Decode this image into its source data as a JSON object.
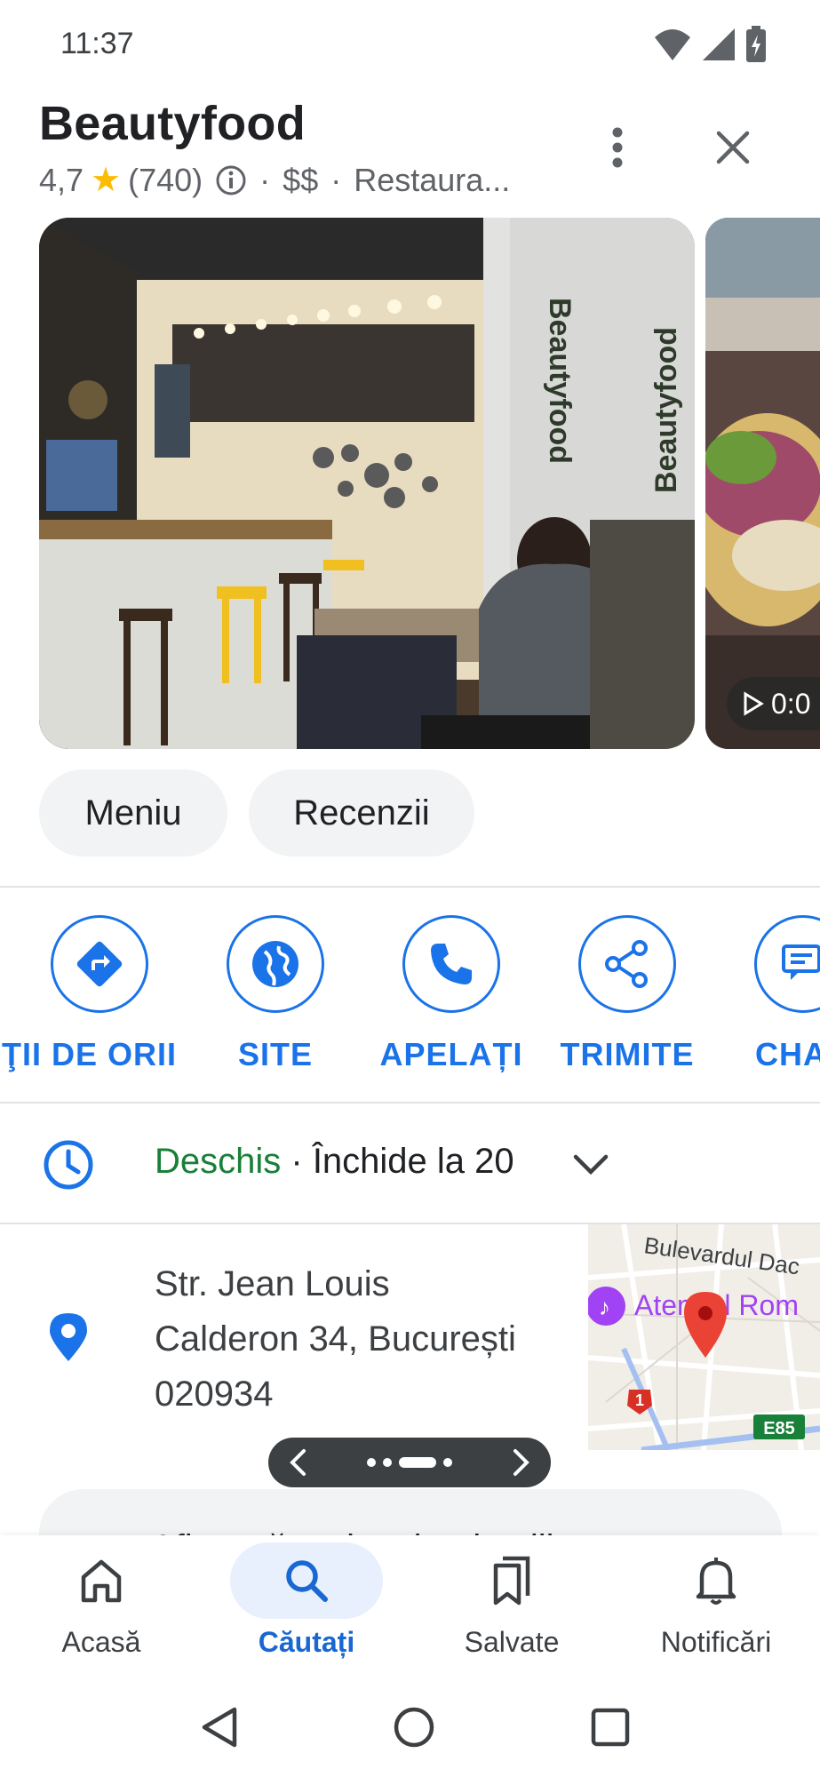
{
  "status_bar": {
    "time": "11:37",
    "icons": [
      "wifi-icon",
      "signal-icon",
      "battery-charging-icon"
    ]
  },
  "place": {
    "name": "Beautyfood",
    "rating": "4,7",
    "review_count": "(740)",
    "price": "$$",
    "category": "Restaura...",
    "dot_separator": "·"
  },
  "photos": {
    "sign_text": "Beautyfood",
    "video_label": "0:0"
  },
  "chips": {
    "menu": "Meniu",
    "reviews": "Recenzii"
  },
  "actions": [
    {
      "name": "directions",
      "label": "ŢII DE ORII",
      "icon": "directions-icon"
    },
    {
      "name": "website",
      "label": "SITE",
      "icon": "globe-icon"
    },
    {
      "name": "call",
      "label": "APELAȚI",
      "icon": "phone-icon"
    },
    {
      "name": "share",
      "label": "TRIMITE",
      "icon": "share-icon"
    },
    {
      "name": "chat",
      "label": "CHA",
      "icon": "chat-icon"
    }
  ],
  "hours": {
    "status": "Deschis",
    "separator": " · ",
    "closes": "Închide la 20"
  },
  "address": {
    "line1": "Str. Jean Louis",
    "line2": "Calderon 34, București",
    "line3": "020934"
  },
  "map": {
    "street_label": "Bulevardul Dac",
    "poi_label": "Ateneul Rom",
    "road_badge_1": "1",
    "road_badge_e85": "E85"
  },
  "more_details": "Afișează mai multe detalii",
  "bottom_nav": [
    {
      "label": "Acasă",
      "icon": "home-icon"
    },
    {
      "label": "Căutați",
      "icon": "search-icon"
    },
    {
      "label": "Salvate",
      "icon": "saved-icon"
    },
    {
      "label": "Notificări",
      "icon": "bell-icon"
    }
  ],
  "colors": {
    "accent": "#1a73e8",
    "open": "#188038",
    "star": "#fbbc04",
    "chip_bg": "#f1f3f4",
    "active_nav_bg": "#e8f0fe"
  }
}
